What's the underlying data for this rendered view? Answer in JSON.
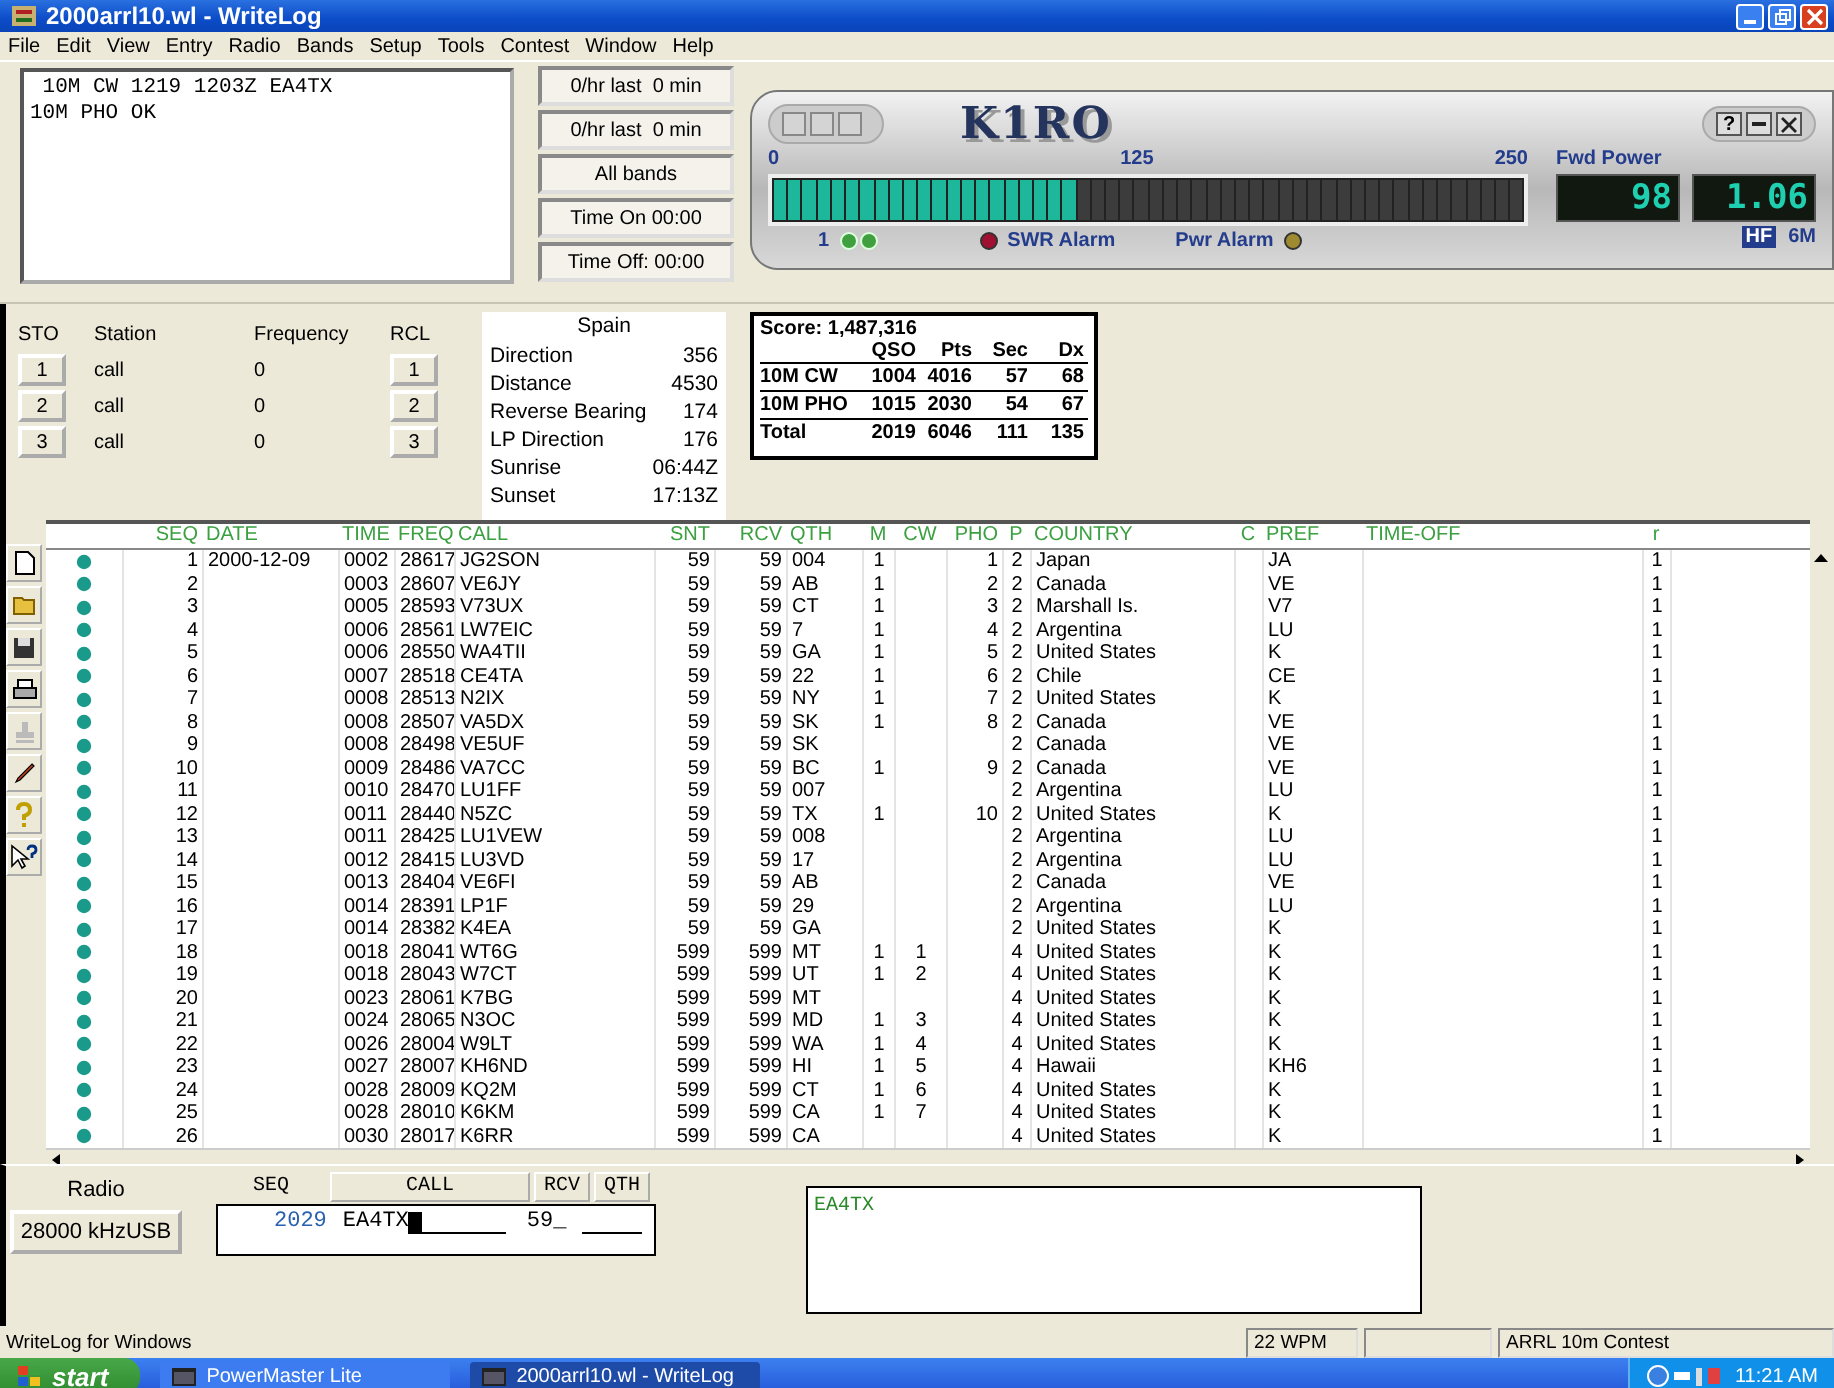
{
  "window": {
    "title": "2000arrl10.wl - WriteLog"
  },
  "menu": [
    "File",
    "Edit",
    "View",
    "Entry",
    "Radio",
    "Bands",
    "Setup",
    "Tools",
    "Contest",
    "Window",
    "Help"
  ],
  "log_messages": [
    " 10M CW 1219 1203Z EA4TX",
    "10M PHO OK"
  ],
  "stat_buttons": [
    "0/hr last  0 min",
    "0/hr last  0 min",
    "All bands",
    "Time On 00:00",
    "Time Off: 00:00"
  ],
  "power_meter": {
    "logo": "K1RO",
    "help": "?",
    "scale": [
      "0",
      "125",
      "250"
    ],
    "level": 0.41,
    "title": "Fwd Power",
    "readouts": [
      "98",
      "1.06"
    ],
    "channel": "1",
    "swr_alarm": "SWR Alarm",
    "pwr_alarm": "Pwr Alarm",
    "band_hf": "HF",
    "band_6m": "6M"
  },
  "memory": {
    "headers": [
      "STO",
      "Station",
      "Frequency",
      "RCL"
    ],
    "rows": [
      {
        "sto": "1",
        "station": "call",
        "frequency": "0",
        "rcl": "1"
      },
      {
        "sto": "2",
        "station": "call",
        "frequency": "0",
        "rcl": "2"
      },
      {
        "sto": "3",
        "station": "call",
        "frequency": "0",
        "rcl": "3"
      }
    ]
  },
  "country_info": {
    "country": "Spain",
    "rows": [
      {
        "label": "Direction",
        "value": "356"
      },
      {
        "label": "Distance",
        "value": "4530"
      },
      {
        "label": "Reverse Bearing",
        "value": "174"
      },
      {
        "label": "LP Direction",
        "value": "176"
      },
      {
        "label": "Sunrise",
        "value": "06:44Z"
      },
      {
        "label": "Sunset",
        "value": "17:13Z"
      }
    ]
  },
  "score": {
    "title": "Score: 1,487,316",
    "headers": [
      "QSO",
      "Pts",
      "Sec",
      "Dx"
    ],
    "rows": [
      {
        "label": "10M CW",
        "values": [
          "1004",
          "4016",
          "57",
          "68"
        ]
      },
      {
        "label": "10M PHO",
        "values": [
          "1015",
          "2030",
          "54",
          "67"
        ]
      },
      {
        "label": "Total",
        "values": [
          "2019",
          "6046",
          "111",
          "135"
        ]
      }
    ]
  },
  "log_table": {
    "columns": [
      "SEQ",
      "DATE",
      "TIME",
      "FREQ",
      "CALL",
      "SNT",
      "RCV",
      "QTH",
      "M",
      "CW",
      "PHO",
      "P",
      "COUNTRY",
      "C",
      "PREF",
      "TIME-OFF",
      "r"
    ],
    "rows": [
      {
        "seq": "1",
        "date": "2000-12-09",
        "time": "0002",
        "freq": "28617",
        "call": "JG2SON",
        "snt": "59",
        "rcv": "59",
        "qth": "004",
        "m": "1",
        "pho": "1",
        "p": "2",
        "country": "Japan",
        "pref": "JA",
        "r": "1"
      },
      {
        "seq": "2",
        "time": "0003",
        "freq": "28607",
        "call": "VE6JY",
        "snt": "59",
        "rcv": "59",
        "qth": "AB",
        "m": "1",
        "pho": "2",
        "p": "2",
        "country": "Canada",
        "pref": "VE",
        "r": "1"
      },
      {
        "seq": "3",
        "time": "0005",
        "freq": "28593",
        "call": "V73UX",
        "snt": "59",
        "rcv": "59",
        "qth": "CT",
        "m": "1",
        "pho": "3",
        "p": "2",
        "country": "Marshall Is.",
        "pref": "V7",
        "r": "1"
      },
      {
        "seq": "4",
        "time": "0006",
        "freq": "28561",
        "call": "LW7EIC",
        "snt": "59",
        "rcv": "59",
        "qth": "7",
        "m": "1",
        "pho": "4",
        "p": "2",
        "country": "Argentina",
        "pref": "LU",
        "r": "1"
      },
      {
        "seq": "5",
        "time": "0006",
        "freq": "28550",
        "call": "WA4TII",
        "snt": "59",
        "rcv": "59",
        "qth": "GA",
        "m": "1",
        "pho": "5",
        "p": "2",
        "country": "United States",
        "pref": "K",
        "r": "1"
      },
      {
        "seq": "6",
        "time": "0007",
        "freq": "28518",
        "call": "CE4TA",
        "snt": "59",
        "rcv": "59",
        "qth": "22",
        "m": "1",
        "pho": "6",
        "p": "2",
        "country": "Chile",
        "pref": "CE",
        "r": "1"
      },
      {
        "seq": "7",
        "time": "0008",
        "freq": "28513",
        "call": "N2IX",
        "snt": "59",
        "rcv": "59",
        "qth": "NY",
        "m": "1",
        "pho": "7",
        "p": "2",
        "country": "United States",
        "pref": "K",
        "r": "1"
      },
      {
        "seq": "8",
        "time": "0008",
        "freq": "28507",
        "call": "VA5DX",
        "snt": "59",
        "rcv": "59",
        "qth": "SK",
        "m": "1",
        "pho": "8",
        "p": "2",
        "country": "Canada",
        "pref": "VE",
        "r": "1"
      },
      {
        "seq": "9",
        "time": "0008",
        "freq": "28498",
        "call": "VE5UF",
        "snt": "59",
        "rcv": "59",
        "qth": "SK",
        "p": "2",
        "country": "Canada",
        "pref": "VE",
        "r": "1"
      },
      {
        "seq": "10",
        "time": "0009",
        "freq": "28486",
        "call": "VA7CC",
        "snt": "59",
        "rcv": "59",
        "qth": "BC",
        "m": "1",
        "pho": "9",
        "p": "2",
        "country": "Canada",
        "pref": "VE",
        "r": "1"
      },
      {
        "seq": "11",
        "time": "0010",
        "freq": "28470",
        "call": "LU1FF",
        "snt": "59",
        "rcv": "59",
        "qth": "007",
        "p": "2",
        "country": "Argentina",
        "pref": "LU",
        "r": "1"
      },
      {
        "seq": "12",
        "time": "0011",
        "freq": "28440",
        "call": "N5ZC",
        "snt": "59",
        "rcv": "59",
        "qth": "TX",
        "m": "1",
        "pho": "10",
        "p": "2",
        "country": "United States",
        "pref": "K",
        "r": "1"
      },
      {
        "seq": "13",
        "time": "0011",
        "freq": "28425",
        "call": "LU1VEW",
        "snt": "59",
        "rcv": "59",
        "qth": "008",
        "p": "2",
        "country": "Argentina",
        "pref": "LU",
        "r": "1"
      },
      {
        "seq": "14",
        "time": "0012",
        "freq": "28415",
        "call": "LU3VD",
        "snt": "59",
        "rcv": "59",
        "qth": "17",
        "p": "2",
        "country": "Argentina",
        "pref": "LU",
        "r": "1"
      },
      {
        "seq": "15",
        "time": "0013",
        "freq": "28404",
        "call": "VE6FI",
        "snt": "59",
        "rcv": "59",
        "qth": "AB",
        "p": "2",
        "country": "Canada",
        "pref": "VE",
        "r": "1"
      },
      {
        "seq": "16",
        "time": "0014",
        "freq": "28391",
        "call": "LP1F",
        "snt": "59",
        "rcv": "59",
        "qth": "29",
        "p": "2",
        "country": "Argentina",
        "pref": "LU",
        "r": "1"
      },
      {
        "seq": "17",
        "time": "0014",
        "freq": "28382",
        "call": "K4EA",
        "snt": "59",
        "rcv": "59",
        "qth": "GA",
        "p": "2",
        "country": "United States",
        "pref": "K",
        "r": "1"
      },
      {
        "seq": "18",
        "time": "0018",
        "freq": "28041",
        "call": "WT6G",
        "snt": "599",
        "rcv": "599",
        "qth": "MT",
        "m": "1",
        "cw": "1",
        "p": "4",
        "country": "United States",
        "pref": "K",
        "r": "1"
      },
      {
        "seq": "19",
        "time": "0018",
        "freq": "28043",
        "call": "W7CT",
        "snt": "599",
        "rcv": "599",
        "qth": "UT",
        "m": "1",
        "cw": "2",
        "p": "4",
        "country": "United States",
        "pref": "K",
        "r": "1"
      },
      {
        "seq": "20",
        "time": "0023",
        "freq": "28061",
        "call": "K7BG",
        "snt": "599",
        "rcv": "599",
        "qth": "MT",
        "p": "4",
        "country": "United States",
        "pref": "K",
        "r": "1"
      },
      {
        "seq": "21",
        "time": "0024",
        "freq": "28065",
        "call": "N3OC",
        "snt": "599",
        "rcv": "599",
        "qth": "MD",
        "m": "1",
        "cw": "3",
        "p": "4",
        "country": "United States",
        "pref": "K",
        "r": "1"
      },
      {
        "seq": "22",
        "time": "0026",
        "freq": "28004",
        "call": "W9LT",
        "snt": "599",
        "rcv": "599",
        "qth": "WA",
        "m": "1",
        "cw": "4",
        "p": "4",
        "country": "United States",
        "pref": "K",
        "r": "1"
      },
      {
        "seq": "23",
        "time": "0027",
        "freq": "28007",
        "call": "KH6ND",
        "snt": "599",
        "rcv": "599",
        "qth": "HI",
        "m": "1",
        "cw": "5",
        "p": "4",
        "country": "Hawaii",
        "pref": "KH6",
        "r": "1"
      },
      {
        "seq": "24",
        "time": "0028",
        "freq": "28009",
        "call": "KQ2M",
        "snt": "599",
        "rcv": "599",
        "qth": "CT",
        "m": "1",
        "cw": "6",
        "p": "4",
        "country": "United States",
        "pref": "K",
        "r": "1"
      },
      {
        "seq": "25",
        "time": "0028",
        "freq": "28010",
        "call": "K6KM",
        "snt": "599",
        "rcv": "599",
        "qth": "CA",
        "m": "1",
        "cw": "7",
        "p": "4",
        "country": "United States",
        "pref": "K",
        "r": "1"
      },
      {
        "seq": "26",
        "time": "0030",
        "freq": "28017",
        "call": "K6RR",
        "snt": "599",
        "rcv": "599",
        "qth": "CA",
        "p": "4",
        "country": "United States",
        "pref": "K",
        "r": "1"
      }
    ]
  },
  "radio": {
    "label": "Radio",
    "frequency": "28000 kHzUSB"
  },
  "entry": {
    "seq_label": "SEQ",
    "headers": [
      "CALL",
      "RCV",
      "QTH"
    ],
    "seq": "2029",
    "call": "EA4TX",
    "rcv": "59_"
  },
  "check_window": {
    "text": "EA4TX"
  },
  "status_bar": [
    "WriteLog for Windows",
    "22 WPM",
    "ARRL 10m Contest"
  ],
  "taskbar": {
    "start": "start",
    "tasks": [
      {
        "label": "PowerMaster Lite",
        "selected": false
      },
      {
        "label": "2000arrl10.wl - WriteLog",
        "selected": true
      }
    ],
    "clock": "11:21 AM"
  }
}
